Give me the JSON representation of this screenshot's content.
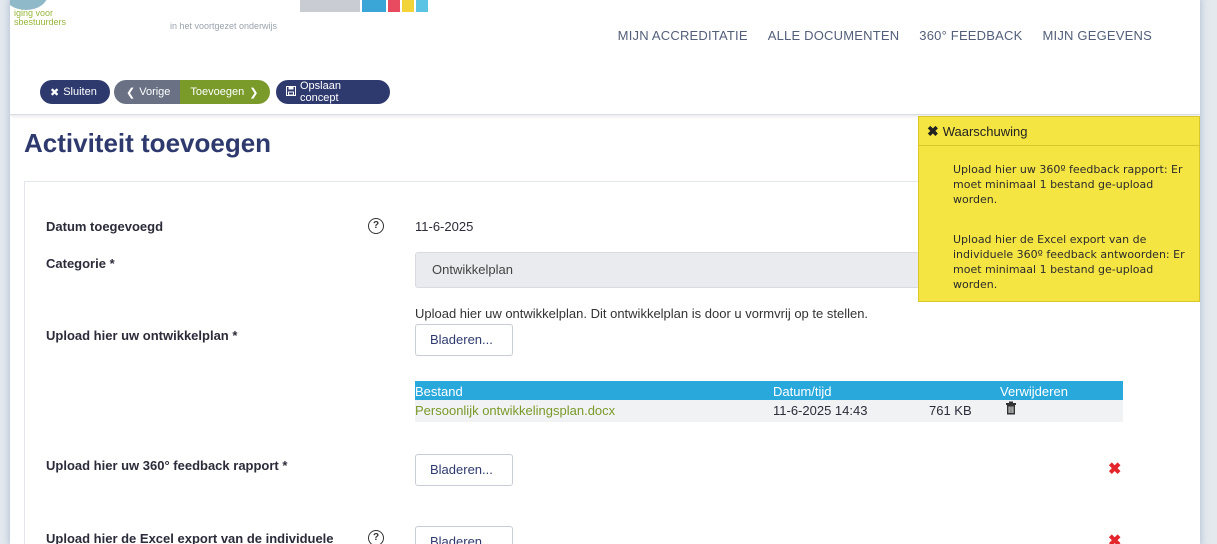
{
  "header": {
    "logo_sub1": "iging voor",
    "logo_sub2": "sbestuurders",
    "logo_tag1": "",
    "logo_tag2": "in het voortgezet onderwijs",
    "nav": [
      "MIJN ACCREDITATIE",
      "ALLE DOCUMENTEN",
      "360° FEEDBACK",
      "MIJN GEGEVENS"
    ]
  },
  "toolbar": {
    "close_label": "Sluiten",
    "prev_label": "Vorige",
    "add_label": "Toevoegen",
    "save_label": "Opslaan concept"
  },
  "page": {
    "title": "Activiteit toevoegen"
  },
  "form": {
    "date_label": "Datum toegevoegd",
    "date_value": "11-6-2025",
    "category_label": "Categorie *",
    "category_value": "Ontwikkelplan",
    "plan_label": "Upload hier uw ontwikkelplan *",
    "plan_hint": "Upload hier uw ontwikkelplan. Dit ontwikkelplan is door u vormvrij op te stellen.",
    "browse_label": "Bladeren...",
    "file_table": {
      "headers": [
        "Bestand",
        "Datum/tijd",
        "Verwijderen"
      ],
      "rows": [
        {
          "name": "Persoonlijk ontwikkelingsplan.docx",
          "datetime": "11-6-2025 14:43",
          "size": "761 KB"
        }
      ]
    },
    "feedback_label": "Upload hier uw 360° feedback rapport *",
    "excel_label": "Upload hier de Excel export van de individuele"
  },
  "warning": {
    "title": "Waarschuwing",
    "messages": [
      "Upload hier uw 360º feedback rapport: Er moet minimaal 1 bestand ge-upload worden.",
      "Upload hier de Excel export van de individuele 360º feedback antwoorden: Er moet minimaal 1 bestand ge-upload worden."
    ]
  },
  "colors": {
    "navy": "#2e3a6e",
    "green": "#7a9a2a",
    "table_header": "#29a8dc",
    "warning_bg": "#f5e542",
    "error": "#e3262b"
  },
  "icons": [
    "close-icon",
    "chevron-left-icon",
    "chevron-right-icon",
    "floppy-icon",
    "help-icon",
    "trash-icon",
    "error-x-icon"
  ]
}
